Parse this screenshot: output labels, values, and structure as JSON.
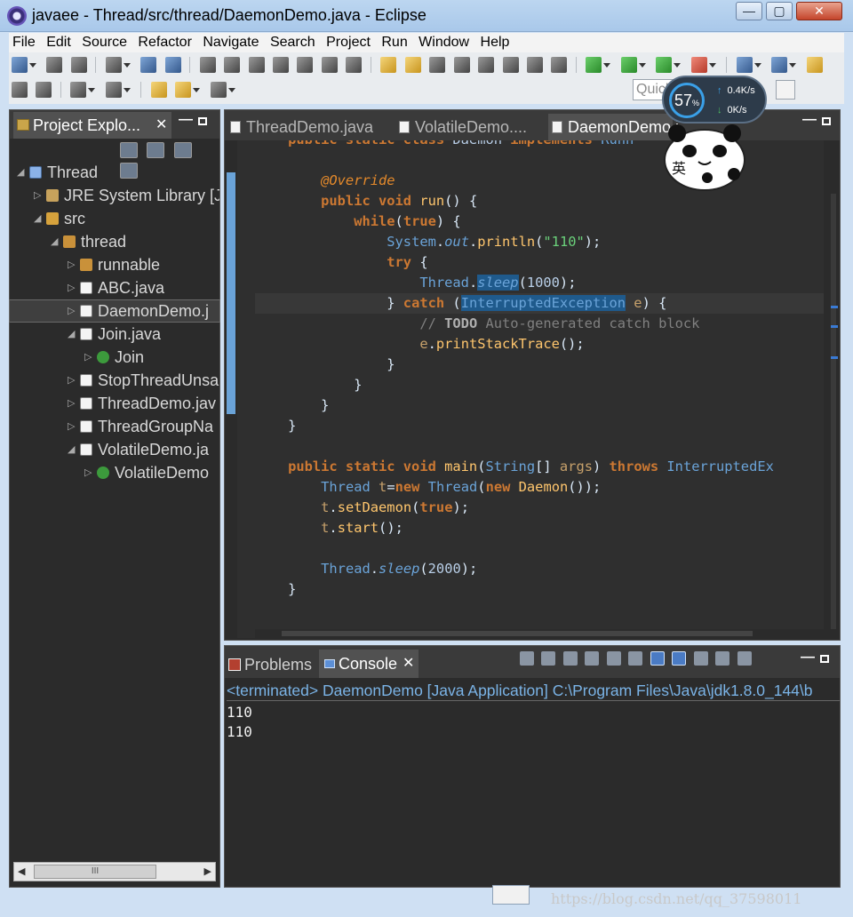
{
  "window": {
    "title": "javaee - Thread/src/thread/DaemonDemo.java - Eclipse",
    "controls": {
      "minimize": "—",
      "maximize": "▢",
      "close": "✕"
    }
  },
  "menu": [
    "File",
    "Edit",
    "Source",
    "Refactor",
    "Navigate",
    "Search",
    "Project",
    "Run",
    "Window",
    "Help"
  ],
  "quick_access": {
    "placeholder": "Quick Access"
  },
  "net_widget": {
    "percent": "57",
    "unit": "%",
    "upload": "0.4",
    "upload_unit": "K/s",
    "download": "0",
    "download_unit": "K/s"
  },
  "sticker": {
    "text": "英"
  },
  "project_explorer": {
    "tab_label": "Project Explo...",
    "tree": [
      {
        "label": "Thread",
        "level": 0,
        "twisty": "◢",
        "icon": "project-icon"
      },
      {
        "label": "JRE System Library [J",
        "level": 1,
        "twisty": "▷",
        "icon": "library-icon"
      },
      {
        "label": "src",
        "level": 1,
        "twisty": "◢",
        "icon": "source-folder-icon"
      },
      {
        "label": "thread",
        "level": 2,
        "twisty": "◢",
        "icon": "package-icon"
      },
      {
        "label": "runnable",
        "level": 3,
        "twisty": "▷",
        "icon": "package-icon"
      },
      {
        "label": "ABC.java",
        "level": 3,
        "twisty": "▷",
        "icon": "java-file-icon"
      },
      {
        "label": "DaemonDemo.j",
        "level": 3,
        "twisty": "▷",
        "icon": "java-file-icon",
        "selected": true
      },
      {
        "label": "Join.java",
        "level": 3,
        "twisty": "◢",
        "icon": "java-file-icon"
      },
      {
        "label": "Join",
        "level": 4,
        "twisty": "▷",
        "icon": "class-icon"
      },
      {
        "label": "StopThreadUnsa",
        "level": 3,
        "twisty": "▷",
        "icon": "java-file-icon"
      },
      {
        "label": "ThreadDemo.jav",
        "level": 3,
        "twisty": "▷",
        "icon": "java-file-icon"
      },
      {
        "label": "ThreadGroupNa",
        "level": 3,
        "twisty": "▷",
        "icon": "java-file-icon"
      },
      {
        "label": "VolatileDemo.ja",
        "level": 3,
        "twisty": "◢",
        "icon": "java-file-icon"
      },
      {
        "label": "VolatileDemo",
        "level": 4,
        "twisty": "▷",
        "icon": "class-icon"
      }
    ],
    "hscroll_thumb": "III"
  },
  "editor": {
    "tabs": [
      {
        "label": "ThreadDemo.java",
        "active": false
      },
      {
        "label": "VolatileDemo....",
        "active": false
      },
      {
        "label": "DaemonDemo.j",
        "active": true
      }
    ],
    "code_lines": [
      "    public static class Daemon implements Runn",
      "",
      "        @Override",
      "        public void run() {",
      "            while(true) {",
      "                System.out.println(\"110\");",
      "                try {",
      "                    Thread.sleep(1000);",
      "                } catch (InterruptedException e) {",
      "                    // TODO Auto-generated catch block",
      "                    e.printStackTrace();",
      "                }",
      "            }",
      "        }",
      "    }",
      "",
      "    public static void main(String[] args) throws InterruptedEx",
      "        Thread t=new Thread(new Daemon());",
      "        t.setDaemon(true);",
      "        t.start();",
      "",
      "        Thread.sleep(2000);",
      "    }"
    ]
  },
  "console": {
    "tabs": {
      "problems": "Problems",
      "console": "Console"
    },
    "header": "<terminated> DaemonDemo [Java Application] C:\\Program Files\\Java\\jdk1.8.0_144\\b",
    "output": [
      "110",
      "110"
    ]
  },
  "watermark": "https://blog.csdn.net/qq_37598011",
  "colors": {
    "background": "#2b2b2b",
    "keyword": "#cc7832",
    "type": "#6aa3d8",
    "string": "#6ad07a",
    "accent": "#3aa0e8"
  }
}
